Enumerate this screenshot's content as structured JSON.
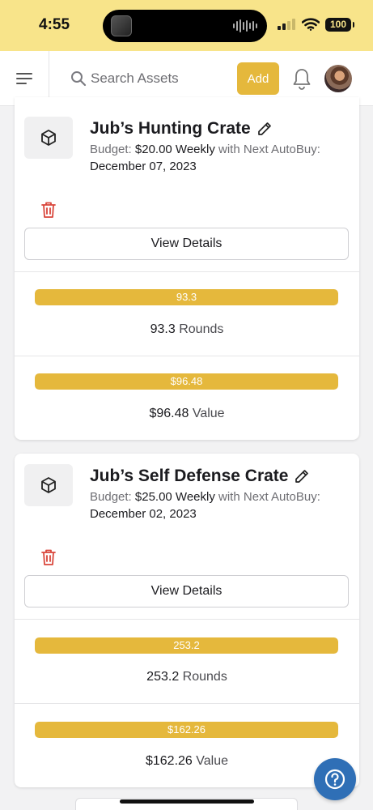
{
  "status_bar": {
    "time": "4:55",
    "battery": "100"
  },
  "header": {
    "menu_icon": "hamburger-menu-icon",
    "search_placeholder": "Search Assets",
    "add_label": "Add",
    "bell_icon": "bell-icon"
  },
  "crates": [
    {
      "title": "Jub’s Hunting Crate",
      "budget_label": "Budget:",
      "budget_value": "$20.00 Weekly",
      "next_label": "with Next AutoBuy:",
      "next_date": "December 07, 2023",
      "view_label": "View Details",
      "rounds_bar_label": "93.3",
      "rounds_value": "93.3",
      "rounds_unit": "Rounds",
      "rounds_fill_pct": 100,
      "value_bar_label": "$96.48",
      "value_value": "$96.48",
      "value_unit": "Value",
      "value_fill_pct": 100
    },
    {
      "title": "Jub’s Self Defense Crate",
      "budget_label": "Budget:",
      "budget_value": "$25.00 Weekly",
      "next_label": "with Next AutoBuy:",
      "next_date": "December 02, 2023",
      "view_label": "View Details",
      "rounds_bar_label": "253.2",
      "rounds_value": "253.2",
      "rounds_unit": "Rounds",
      "rounds_fill_pct": 100,
      "value_bar_label": "$162.26",
      "value_value": "$162.26",
      "value_unit": "Value",
      "value_fill_pct": 100
    }
  ],
  "colors": {
    "accent": "#e5b83c",
    "status_bar": "#f8e48a",
    "danger": "#d9463b",
    "help": "#2f6fb6"
  }
}
